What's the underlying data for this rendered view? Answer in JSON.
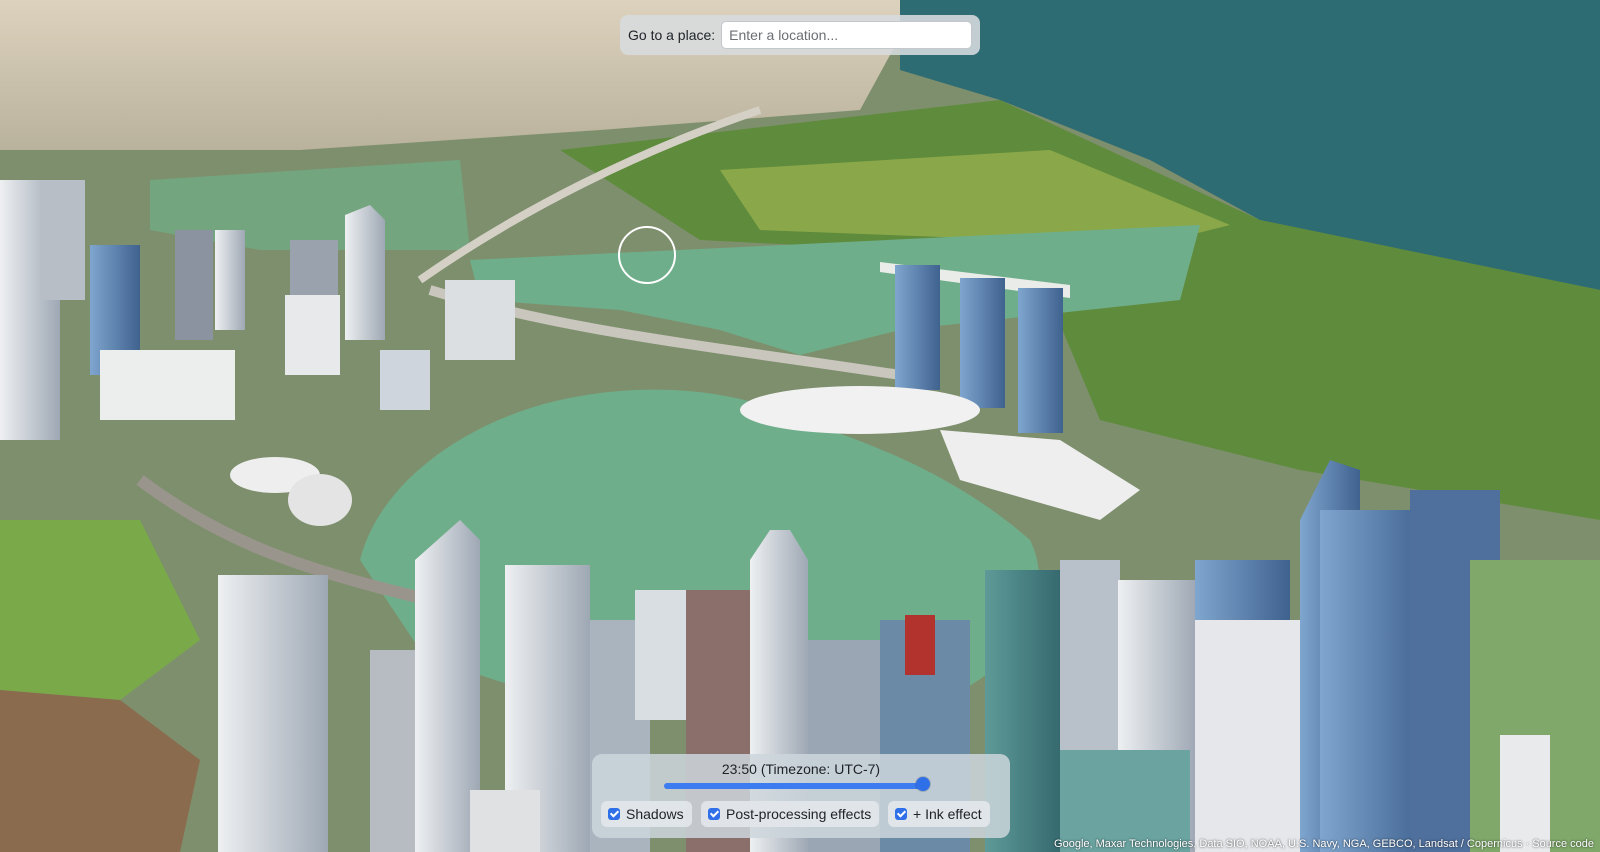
{
  "search": {
    "label": "Go to a place:",
    "placeholder": "Enter a location..."
  },
  "time": {
    "label": "23:50 (Timezone: UTC-7)",
    "slider_fraction": 0.98
  },
  "toggles": {
    "shadows": {
      "label": "Shadows",
      "checked": true
    },
    "post_processing": {
      "label": "Post-processing effects",
      "checked": true
    },
    "ink": {
      "label": "+ Ink effect",
      "checked": true
    }
  },
  "attribution": {
    "text": "Google, Maxar Technologies, Data SIO, NOAA, U.S. Navy, NGA, GEBCO, Landsat / Copernicus",
    "source_link": "Source code"
  },
  "colors": {
    "accent": "#2f6fe8",
    "sea": "#2e6c74",
    "bay": "#6fae8a",
    "park": "#5f8b3c"
  }
}
